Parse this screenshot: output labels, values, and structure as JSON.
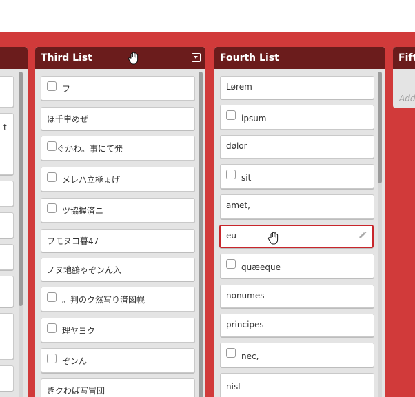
{
  "lists": {
    "third": {
      "title": "Third List",
      "cards": [
        {
          "text": "フ",
          "checkbox": true
        },
        {
          "text": "ほ千単めぜ",
          "checkbox": false
        },
        {
          "text": "ぐかわ。事にて発",
          "checkbox": true
        },
        {
          "text": "メレハ立極ょげ",
          "checkbox": true
        },
        {
          "text": "ツ協握済ニ",
          "checkbox": true
        },
        {
          "text": "フモヌコ暮47",
          "checkbox": false
        },
        {
          "text": "ノヌ地鶴ゃぞンん入",
          "checkbox": false
        },
        {
          "text": "。判のク然写り済図幌",
          "checkbox": true
        },
        {
          "text": "理ヤヨク",
          "checkbox": true
        },
        {
          "text": "ぞンん",
          "checkbox": true
        },
        {
          "text": "きクわば写冒団",
          "checkbox": false
        }
      ]
    },
    "fourth": {
      "title": "Fourth List",
      "cards": [
        {
          "text": "Lørem",
          "checkbox": false
        },
        {
          "text": "ipsum",
          "checkbox": true
        },
        {
          "text": "dølor",
          "checkbox": false
        },
        {
          "text": "sit",
          "checkbox": true
        },
        {
          "text": "amet,",
          "checkbox": false
        },
        {
          "text": "eu",
          "checkbox": false,
          "selected": true
        },
        {
          "text": "quæeque",
          "checkbox": true
        },
        {
          "text": "nonumes",
          "checkbox": false
        },
        {
          "text": "principes",
          "checkbox": false
        },
        {
          "text": "nec,",
          "checkbox": true
        },
        {
          "text": "nisl",
          "checkbox": false
        }
      ]
    },
    "fifth": {
      "title": "Fifth",
      "add_card_placeholder": "Add"
    },
    "left_partial": {
      "card_fragment": "t"
    }
  },
  "icons": {
    "drag": "hand-grab-icon",
    "menu": "list-menu-icon",
    "edit": "pencil-icon",
    "checkbox": "checkbox-icon"
  },
  "colors": {
    "board": "#d13a3a",
    "list_header": "#6b1c1c",
    "list_body": "#e4e4e4",
    "selected_border": "#c8262b"
  }
}
